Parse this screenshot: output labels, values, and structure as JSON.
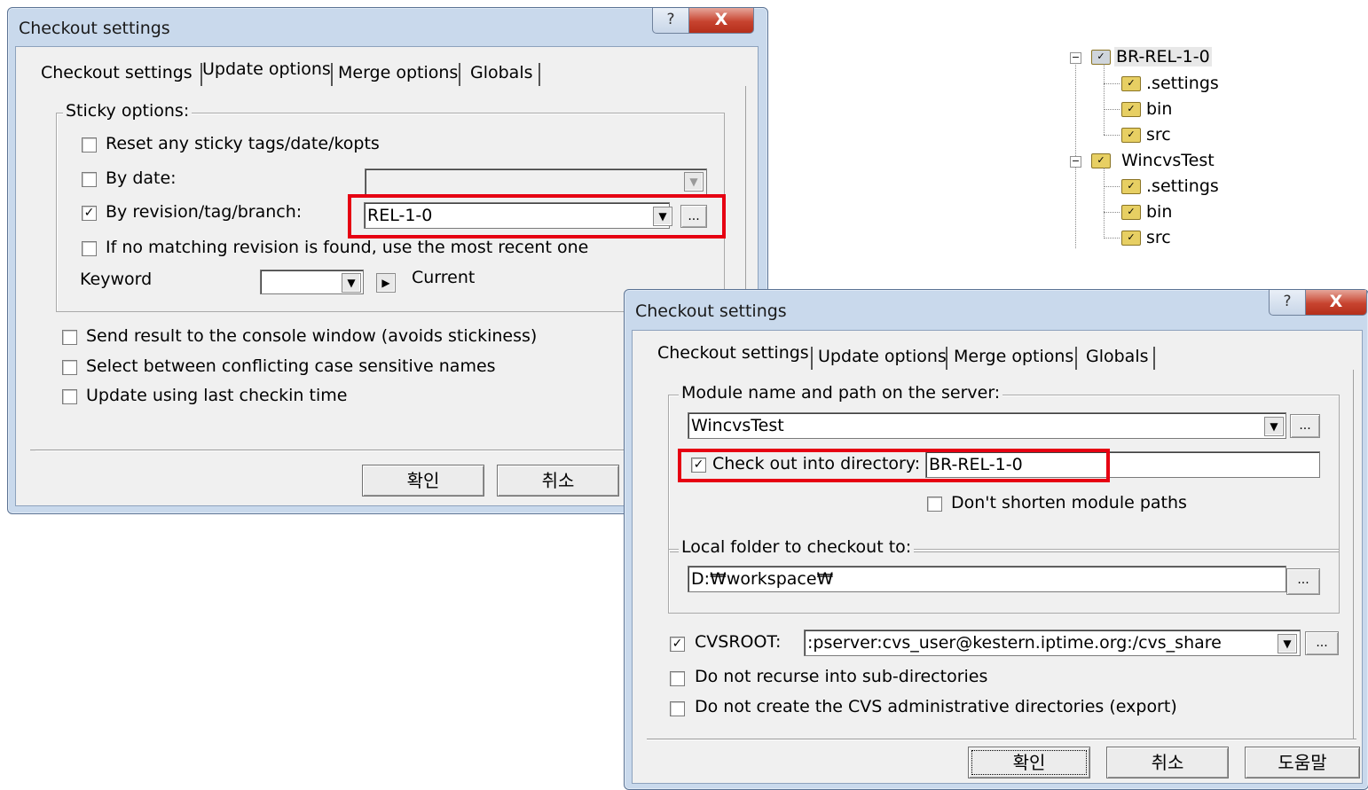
{
  "dialog1": {
    "title": "Checkout settings",
    "help": "?",
    "close": "X",
    "tabs": [
      "Checkout settings",
      "Update options",
      "Merge options",
      "Globals"
    ],
    "sticky_group": "Sticky options:",
    "reset_sticky": {
      "label": "Reset any sticky tags/date/kopts",
      "checked": false
    },
    "by_date": {
      "label": "By date:",
      "checked": false,
      "value": ""
    },
    "by_revision": {
      "label": "By revision/tag/branch:",
      "checked": true,
      "value": "REL-1-0"
    },
    "no_matching": {
      "label": "If no matching revision is found, use the most recent one",
      "checked": false
    },
    "keyword_label": "Keyword",
    "keyword_value": "",
    "keyword_current": "Current",
    "send_result": {
      "label": "Send result to the console window (avoids stickiness)",
      "checked": false
    },
    "select_between": {
      "label": "Select between conflicting case sensitive names",
      "checked": false
    },
    "update_last": {
      "label": "Update using last checkin time",
      "checked": false
    },
    "ok": "확인",
    "cancel": "취소",
    "browse": "..."
  },
  "tree": {
    "nodes": [
      {
        "label": "BR-REL-1-0",
        "children": [
          ".settings",
          "bin",
          "src"
        ]
      },
      {
        "label": "WincvsTest",
        "children": [
          ".settings",
          "bin",
          "src"
        ]
      }
    ],
    "expander": "−"
  },
  "dialog2": {
    "title": "Checkout settings",
    "help": "?",
    "close": "X",
    "tabs": [
      "Checkout settings",
      "Update options",
      "Merge options",
      "Globals"
    ],
    "module_group": "Module name and path on the server:",
    "module_value": "WincvsTest",
    "checkout_into": {
      "label": "Check out into directory:",
      "checked": true,
      "value": "BR-REL-1-0"
    },
    "dont_shorten": {
      "label": "Don't shorten module paths",
      "checked": false
    },
    "local_group": "Local folder to checkout to:",
    "local_value": "D:₩workspace₩",
    "cvsroot": {
      "label": "CVSROOT:",
      "checked": true,
      "value": ":pserver:cvs_user@kestern.iptime.org:/cvs_share"
    },
    "no_recurse": {
      "label": "Do not recurse into sub-directories",
      "checked": false
    },
    "no_admin": {
      "label": "Do not create the CVS administrative directories (export)",
      "checked": false
    },
    "ok": "확인",
    "cancel": "취소",
    "help_button": "도움말",
    "browse": "..."
  },
  "glyphs": {
    "check": "✓",
    "dropdown": "▼",
    "arrow_right": "▶"
  },
  "colors": {
    "highlight": "#e60012",
    "frame": "#c9d9ec",
    "close": "#c7432f"
  }
}
